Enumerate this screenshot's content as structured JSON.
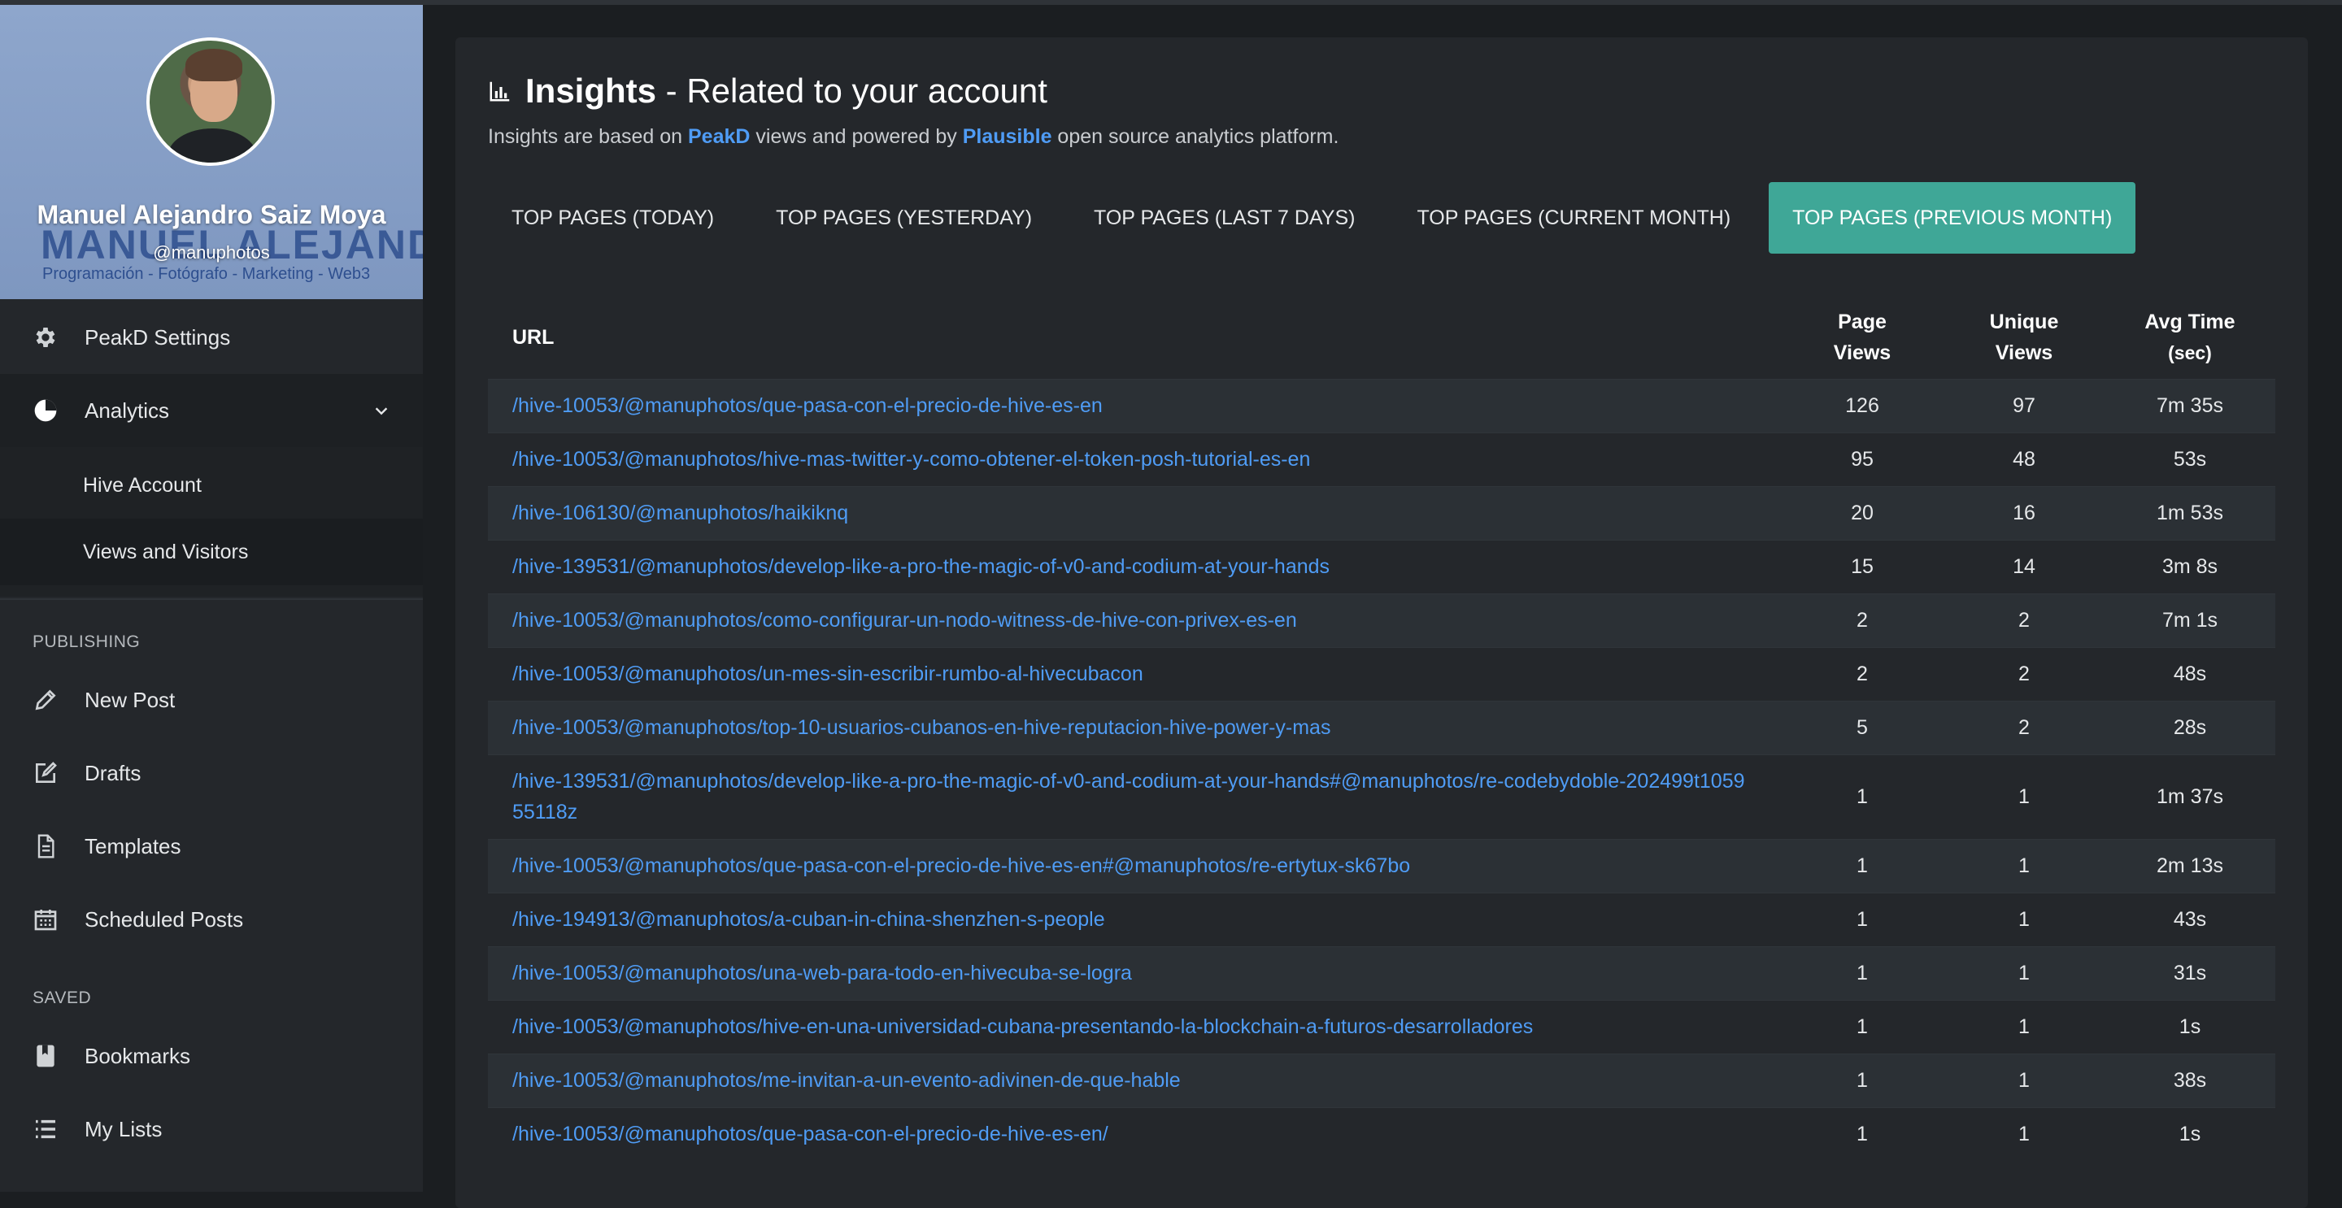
{
  "profile": {
    "name": "Manuel Alejandro Saiz Moya",
    "handle": "@manuphotos",
    "cover_text": "MANUEL ALEJANDRO",
    "cover_tagline": "Programación - Fotógrafo - Marketing - Web3"
  },
  "sidebar": {
    "settings_label": "PeakD Settings",
    "analytics_label": "Analytics",
    "submenu": [
      "Hive Account",
      "Views and Visitors"
    ],
    "publishing_label": "PUBLISHING",
    "publishing_items": [
      "New Post",
      "Drafts",
      "Templates",
      "Scheduled Posts"
    ],
    "saved_label": "SAVED",
    "saved_items": [
      "Bookmarks",
      "My Lists"
    ]
  },
  "insights": {
    "title_strong": "Insights",
    "title_rest": " - Related to your account",
    "subtitle_pre": "Insights are based on ",
    "subtitle_link1": "PeakD",
    "subtitle_mid": " views and powered by ",
    "subtitle_link2": "Plausible",
    "subtitle_post": " open source analytics platform."
  },
  "tabs": [
    "TOP PAGES (TODAY)",
    "TOP PAGES (YESTERDAY)",
    "TOP PAGES (LAST 7 DAYS)",
    "TOP PAGES (CURRENT MONTH)",
    "TOP PAGES (PREVIOUS MONTH)"
  ],
  "active_tab": 4,
  "table": {
    "headers": {
      "url": "URL",
      "page_views_1": "Page",
      "page_views_2": "Views",
      "unique_views_1": "Unique",
      "unique_views_2": "Views",
      "avg_time_1": "Avg Time",
      "avg_time_2": "(sec)"
    },
    "rows": [
      {
        "url": "/hive-10053/@manuphotos/que-pasa-con-el-precio-de-hive-es-en",
        "page_views": "126",
        "unique_views": "97",
        "avg_time": "7m 35s"
      },
      {
        "url": "/hive-10053/@manuphotos/hive-mas-twitter-y-como-obtener-el-token-posh-tutorial-es-en",
        "page_views": "95",
        "unique_views": "48",
        "avg_time": "53s"
      },
      {
        "url": "/hive-106130/@manuphotos/haikiknq",
        "page_views": "20",
        "unique_views": "16",
        "avg_time": "1m 53s"
      },
      {
        "url": "/hive-139531/@manuphotos/develop-like-a-pro-the-magic-of-v0-and-codium-at-your-hands",
        "page_views": "15",
        "unique_views": "14",
        "avg_time": "3m 8s"
      },
      {
        "url": "/hive-10053/@manuphotos/como-configurar-un-nodo-witness-de-hive-con-privex-es-en",
        "page_views": "2",
        "unique_views": "2",
        "avg_time": "7m 1s"
      },
      {
        "url": "/hive-10053/@manuphotos/un-mes-sin-escribir-rumbo-al-hivecubacon",
        "page_views": "2",
        "unique_views": "2",
        "avg_time": "48s"
      },
      {
        "url": "/hive-10053/@manuphotos/top-10-usuarios-cubanos-en-hive-reputacion-hive-power-y-mas",
        "page_views": "5",
        "unique_views": "2",
        "avg_time": "28s"
      },
      {
        "url": "/hive-139531/@manuphotos/develop-like-a-pro-the-magic-of-v0-and-codium-at-your-hands#@manuphotos/re-codebydoble-202499t105955118z",
        "page_views": "1",
        "unique_views": "1",
        "avg_time": "1m 37s"
      },
      {
        "url": "/hive-10053/@manuphotos/que-pasa-con-el-precio-de-hive-es-en#@manuphotos/re-ertytux-sk67bo",
        "page_views": "1",
        "unique_views": "1",
        "avg_time": "2m 13s"
      },
      {
        "url": "/hive-194913/@manuphotos/a-cuban-in-china-shenzhen-s-people",
        "page_views": "1",
        "unique_views": "1",
        "avg_time": "43s"
      },
      {
        "url": "/hive-10053/@manuphotos/una-web-para-todo-en-hivecuba-se-logra",
        "page_views": "1",
        "unique_views": "1",
        "avg_time": "31s"
      },
      {
        "url": "/hive-10053/@manuphotos/hive-en-una-universidad-cubana-presentando-la-blockchain-a-futuros-desarrolladores",
        "page_views": "1",
        "unique_views": "1",
        "avg_time": "1s"
      },
      {
        "url": "/hive-10053/@manuphotos/me-invitan-a-un-evento-adivinen-de-que-hable",
        "page_views": "1",
        "unique_views": "1",
        "avg_time": "38s"
      },
      {
        "url": "/hive-10053/@manuphotos/que-pasa-con-el-precio-de-hive-es-en/",
        "page_views": "1",
        "unique_views": "1",
        "avg_time": "1s"
      }
    ]
  },
  "colors": {
    "accent": "#3fa797",
    "link": "#4f9cf5",
    "background": "#1b1e21",
    "panel": "#24272b"
  }
}
